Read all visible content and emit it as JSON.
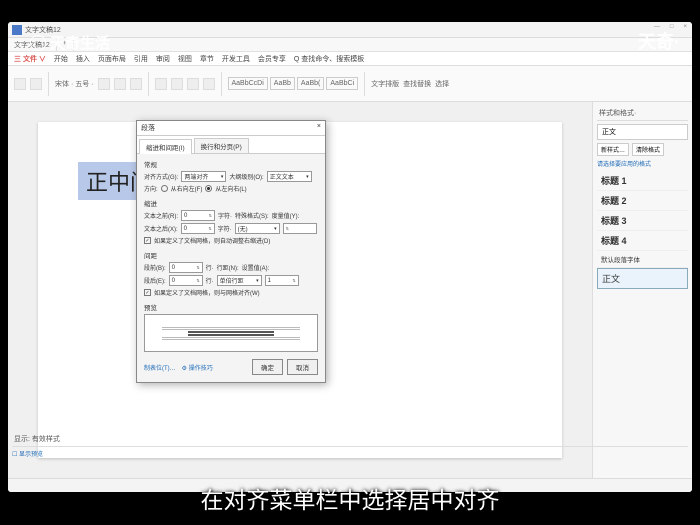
{
  "watermark_left": "天奇生活",
  "watermark_right": "天奇·",
  "subtitle": "在对齐菜单栏中选择居中对齐",
  "titlebar": {
    "doc": "文字文稿12"
  },
  "ribbon_menu": [
    "三 文件 ∨",
    "开始",
    "插入",
    "页面布局",
    "引用",
    "审阅",
    "视图",
    "章节",
    "开发工具",
    "会员专享",
    "Q 查找命令、搜索模板"
  ],
  "ribbon_styles": [
    "AaBbCcDi",
    "AaBb",
    "AaBb(",
    "AaBbCi"
  ],
  "ribbon_right": [
    "文字排版",
    "查找替换",
    "选择"
  ],
  "doc_text": "正中间",
  "dialog": {
    "title": "段落",
    "close": "×",
    "tabs": [
      "缩进和间距(I)",
      "换行和分页(P)"
    ],
    "sec_general": "常规",
    "align_lbl": "对齐方式(G):",
    "align_val": "两端对齐",
    "outline_lbl": "大纲级别(O):",
    "outline_val": "正文文本",
    "dir_lbl": "方向:",
    "dir_rtl": "从右向左(F)",
    "dir_ltr": "从左向右(L)",
    "sec_indent": "缩进",
    "indent_before_lbl": "文本之前(R):",
    "indent_before_val": "0",
    "indent_unit1": "字符·",
    "special_lbl": "特殊格式(S):",
    "special_val": "(无)",
    "metric_lbl": "度量值(Y):",
    "indent_after_lbl": "文本之后(X):",
    "indent_after_val": "0",
    "chk_autoindent": "如果定义了文档网格，则自动调整右缩进(D)",
    "sec_spacing": "间距",
    "space_before_lbl": "段前(B):",
    "space_before_val": "0",
    "space_unit": "行·",
    "linespace_lbl": "行距(N):",
    "linespace_val": "单倍行距",
    "setval_lbl": "设置值(A):",
    "setval_val": "1",
    "space_after_lbl": "段后(E):",
    "space_after_val": "0",
    "chk_grid": "如果定义了文档网格，则与网格对齐(W)",
    "sec_preview": "预览",
    "tabstops": "制表位(T)…",
    "ops": "⚙ 操作技巧",
    "ok": "确定",
    "cancel": "取消"
  },
  "side": {
    "title": "样式和格式·",
    "current": "正文",
    "tab1": "新样式…",
    "tab2": "清除格式",
    "hint": "请选择要应用的格式",
    "items": [
      "标题 1",
      "标题 2",
      "标题 3",
      "标题 4",
      "默认段落字体"
    ],
    "cur_item": "正文",
    "show_lbl": "显示: 有效样式",
    "show_pre": "显示预览"
  }
}
